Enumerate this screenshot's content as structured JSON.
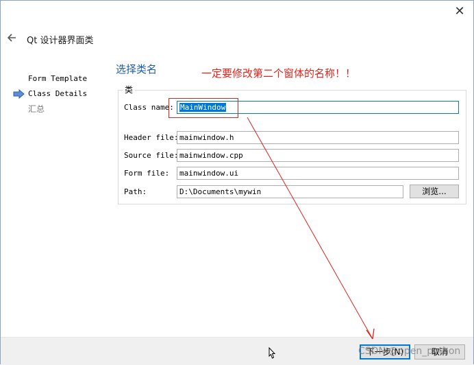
{
  "window": {
    "close_symbol": "✕"
  },
  "wizard": {
    "title": "Qt 设计器界面类"
  },
  "steps": [
    {
      "label": "Form Template",
      "state": "done"
    },
    {
      "label": "Class Details",
      "state": "current"
    },
    {
      "label": "汇总",
      "state": "future"
    }
  ],
  "page": {
    "title": "选择类名"
  },
  "annotation": {
    "text": "一定要修改第二个窗体的名称！！",
    "color": "#e0231c"
  },
  "group": {
    "label": "类",
    "class_name_label": "Class name:",
    "class_name_value": "MainWindow",
    "header_label": "Header file:",
    "header_value": "mainwindow.h",
    "source_label": "Source file:",
    "source_value": "mainwindow.cpp",
    "form_label": "Form file:",
    "form_value": "mainwindow.ui",
    "path_label": "Path:",
    "path_value": "D:\\Documents\\mywin",
    "browse_label": "浏览..."
  },
  "footer": {
    "next_label": "下一步(N)",
    "cancel_label": "取消"
  },
  "watermark": {
    "text": "CSDN @open_python"
  },
  "colors": {
    "accent": "#0078d7",
    "title": "#1f5fa6",
    "annotation": "#e0231c"
  }
}
